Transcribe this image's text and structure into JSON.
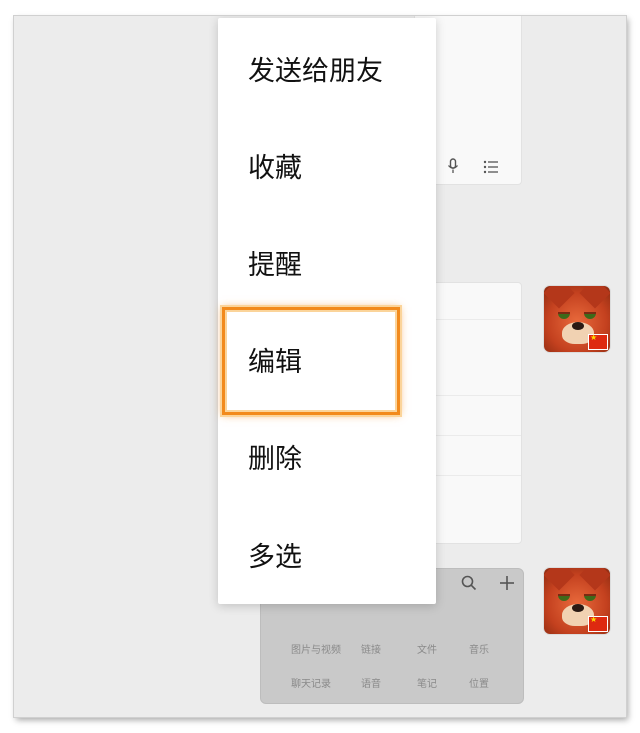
{
  "context_menu": {
    "items": [
      {
        "id": "send-to-friend",
        "label": "发送给朋友"
      },
      {
        "id": "favorite",
        "label": "收藏"
      },
      {
        "id": "remind",
        "label": "提醒"
      },
      {
        "id": "edit",
        "label": "编辑"
      },
      {
        "id": "delete",
        "label": "删除"
      },
      {
        "id": "multi-select",
        "label": "多选"
      }
    ],
    "highlighted_item": "edit"
  },
  "note_toolbar": {
    "icons": [
      "microphone-icon",
      "list-icon"
    ]
  },
  "attachment_panel": {
    "controls": [
      "search-icon",
      "plus-icon"
    ],
    "items": [
      {
        "label": "图片与视频"
      },
      {
        "label": "链接"
      },
      {
        "label": "文件"
      },
      {
        "label": "音乐"
      },
      {
        "label": "聊天记录"
      },
      {
        "label": "语音"
      },
      {
        "label": "笔记"
      },
      {
        "label": "位置"
      }
    ]
  },
  "colors": {
    "highlight": "#f28a1c",
    "background": "#ececec",
    "menu_bg": "#ffffff"
  }
}
